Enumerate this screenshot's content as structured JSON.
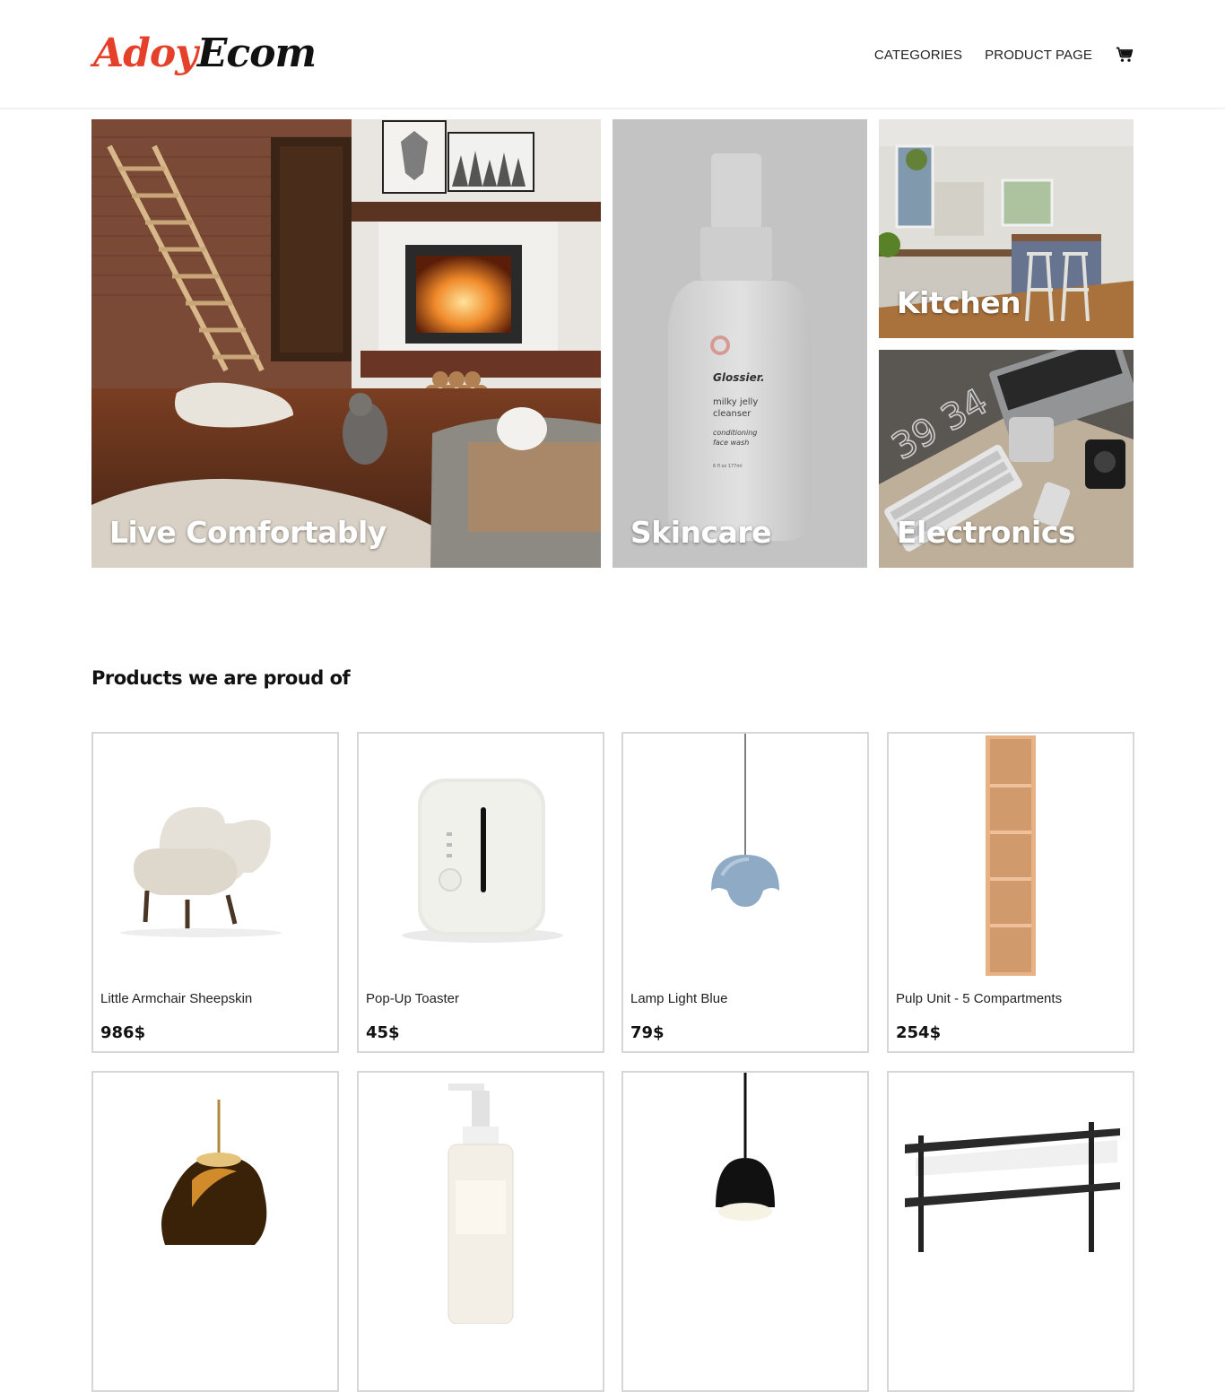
{
  "header": {
    "logo_part1": "Adoy",
    "logo_part2": "Ecom",
    "nav": [
      {
        "label": "CATEGORIES"
      },
      {
        "label": "PRODUCT PAGE"
      }
    ],
    "cart_icon": "cart-icon"
  },
  "hero": {
    "tiles": [
      {
        "label": "Live Comfortably"
      },
      {
        "label": "Skincare"
      },
      {
        "label": "Kitchen"
      },
      {
        "label": "Electronics"
      }
    ],
    "skincare_product_text": {
      "brand": "Glossier.",
      "line1": "milky jelly",
      "line2": "cleanser",
      "line3": "conditioning",
      "line4": "face wash",
      "volume": "6 fl oz  177ml"
    },
    "electronics_wall_text": "39 34"
  },
  "section": {
    "title": "Products we are proud of"
  },
  "products": [
    {
      "name": "Little Armchair Sheepskin",
      "price": "986$"
    },
    {
      "name": "Pop-Up Toaster",
      "price": "45$"
    },
    {
      "name": "Lamp Light Blue",
      "price": "79$"
    },
    {
      "name": "Pulp Unit - 5 Compartments",
      "price": "254$"
    },
    {
      "name": "",
      "price": ""
    },
    {
      "name": "",
      "price": ""
    },
    {
      "name": "",
      "price": ""
    },
    {
      "name": "",
      "price": ""
    }
  ],
  "colors": {
    "logo_red": "#e4402a",
    "logo_black": "#111111",
    "card_border": "#d7d7d7"
  }
}
